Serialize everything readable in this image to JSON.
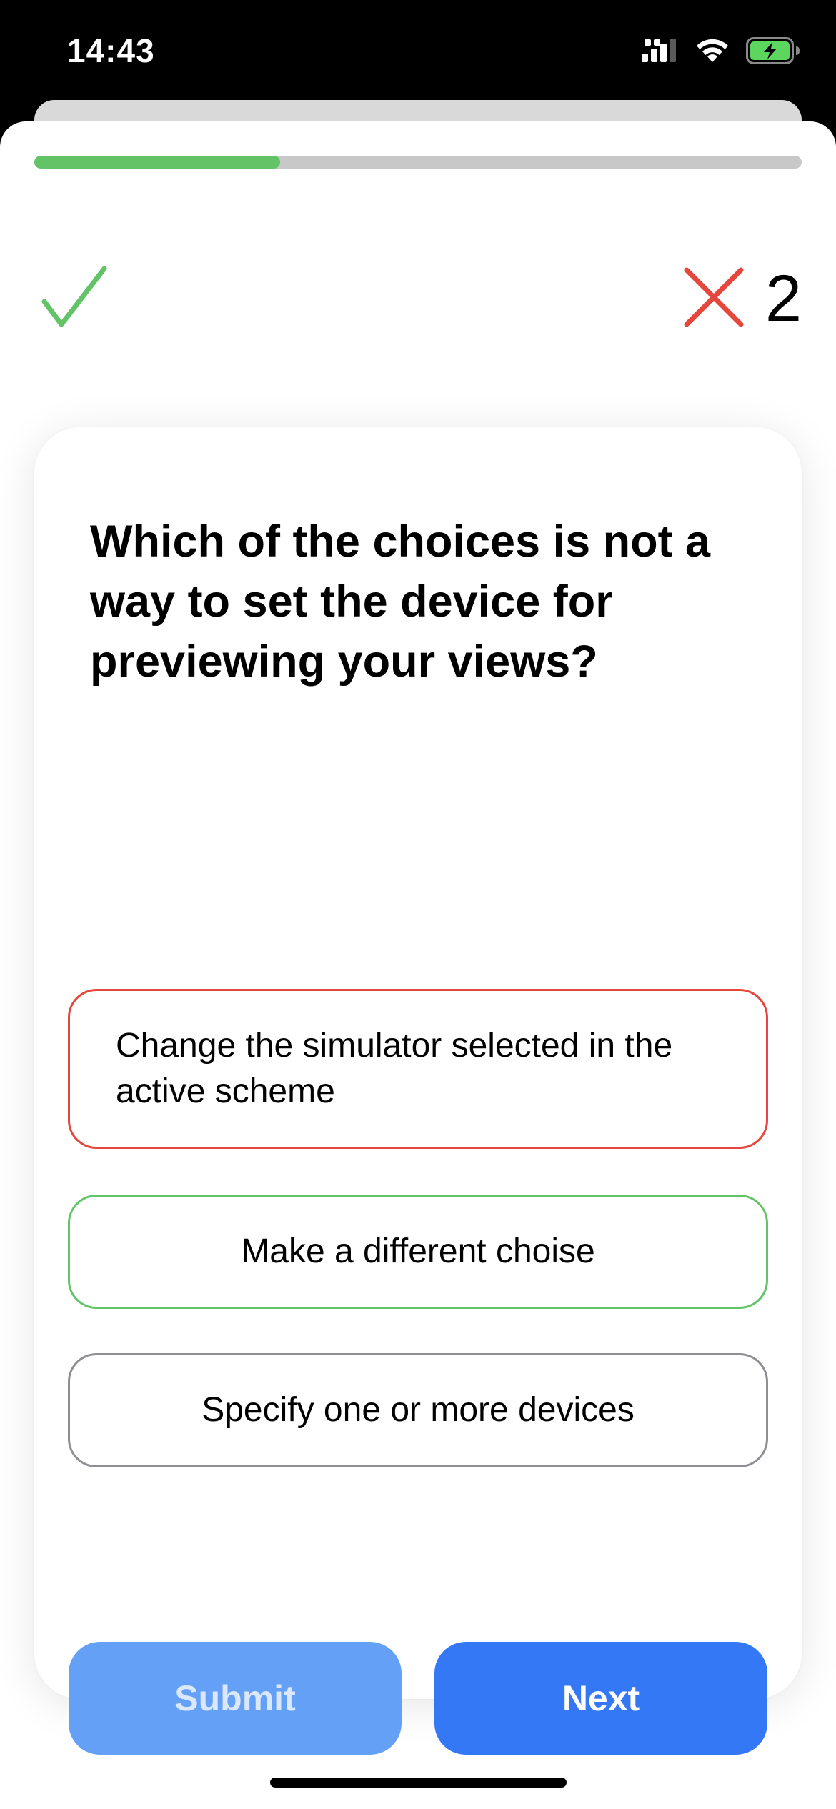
{
  "status_bar": {
    "time": "14:43",
    "icons": [
      "cellular-signal-icon",
      "wifi-icon",
      "battery-charging-icon"
    ],
    "battery_color": "#5dd65f"
  },
  "quiz": {
    "progress": 0.32,
    "progress_color": "#62c466",
    "correct_icon": "checkmark-icon",
    "wrong_icon": "x-mark-icon",
    "wrong_count": "2",
    "question": "Which of the choices is not a way to set the device for previewing your views?",
    "answers": [
      {
        "text": "Change the simulator selected in the active scheme",
        "state": "wrong",
        "border_color": "#e5473d"
      },
      {
        "text": "Make a different choise",
        "state": "correct",
        "border_color": "#62c466"
      },
      {
        "text": "Specify one or more devices",
        "state": "neutral",
        "border_color": "#8e8e93"
      }
    ],
    "submit_label": "Submit",
    "submit_color": "#64a0f6",
    "submit_text_color": "#dbe8fc",
    "next_label": "Next",
    "next_color": "#3478f6",
    "next_text_color": "#ffffff"
  }
}
